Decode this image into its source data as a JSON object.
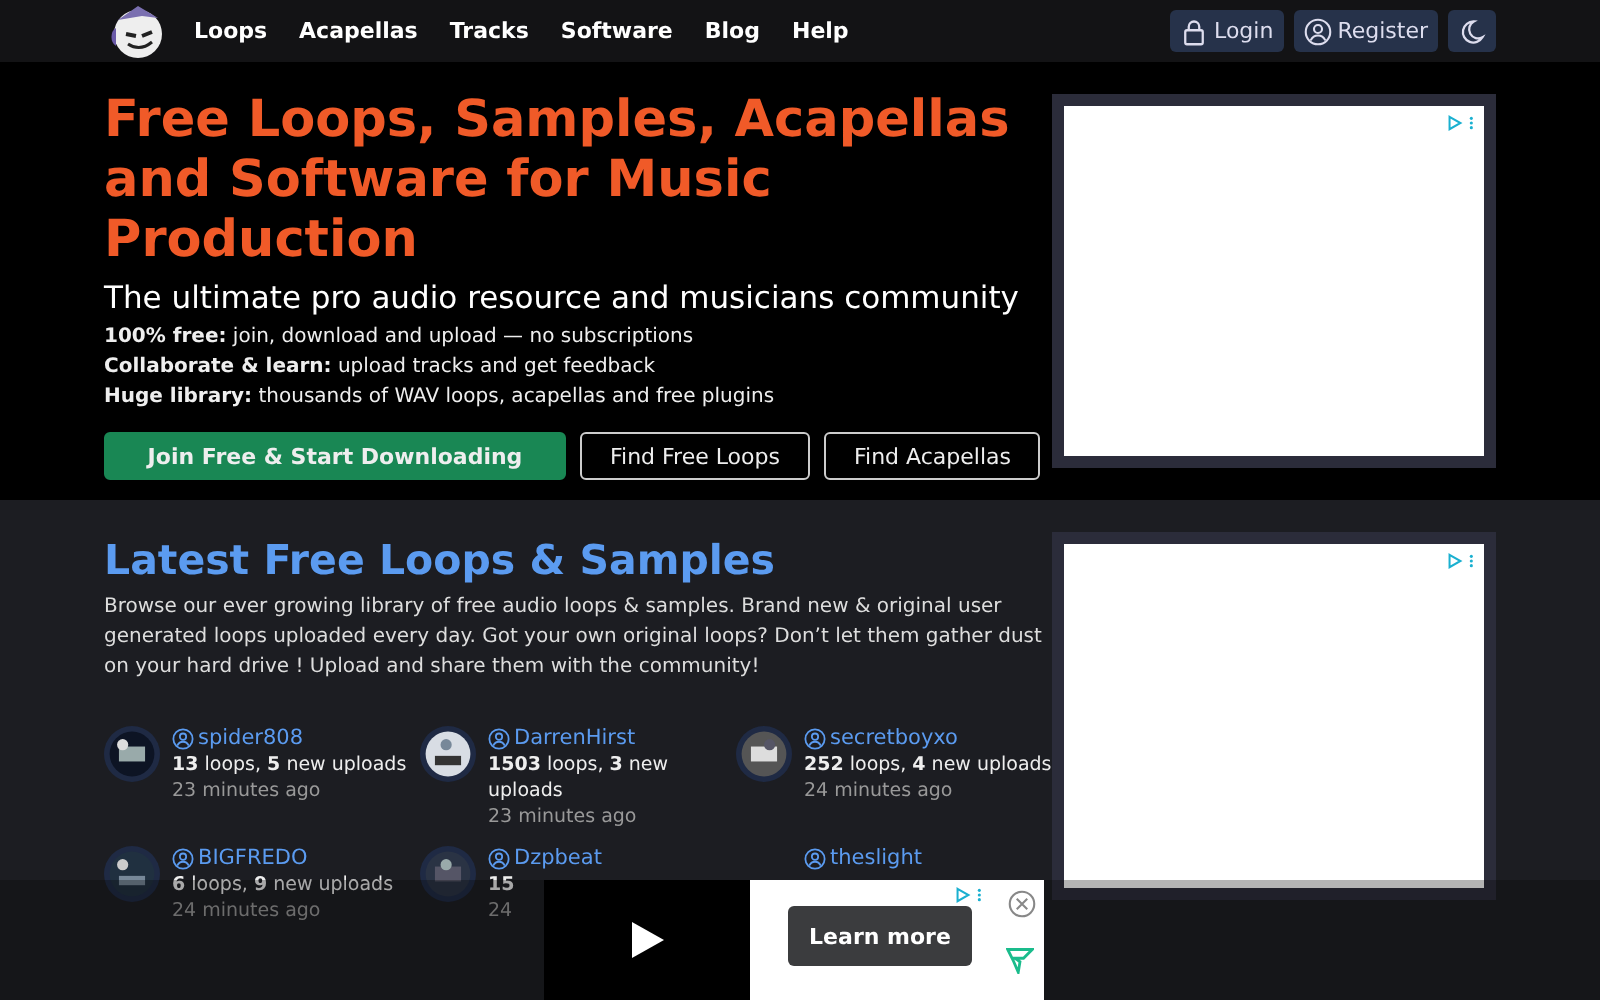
{
  "nav": {
    "links": [
      "Loops",
      "Acapellas",
      "Tracks",
      "Software",
      "Blog",
      "Help"
    ],
    "buttons": [
      {
        "label": "Login",
        "kind": "login"
      },
      {
        "label": "Register",
        "kind": "register"
      }
    ]
  },
  "hero": {
    "title": "Free Loops, Samples, Acapellas and Software for Music Production",
    "subtitle": "The ultimate pro audio resource and musicians community",
    "features": [
      {
        "label": "100% free:",
        "text": "join, download and upload — no subscriptions"
      },
      {
        "label": "Collaborate & learn:",
        "text": "upload tracks and get feedback"
      },
      {
        "label": "Huge library:",
        "text": "thousands of WAV loops, acapellas and free plugins"
      }
    ],
    "buttons": [
      {
        "label": "Join Free & Start Downloading",
        "primary": true
      },
      {
        "label": "Find Free Loops",
        "primary": false
      },
      {
        "label": "Find Acapellas",
        "primary": false
      }
    ]
  },
  "latest": {
    "heading": "Latest Free Loops & Samples",
    "intro": "Browse our ever growing library of free audio loops & samples. Brand new & original user generated loops uploaded every day. Got your own original loops? Don’t let them gather dust on your hard drive ! Upload and share them with the community!",
    "users": [
      {
        "name": "spider808",
        "stats": "**13** loops, **5** new uploads",
        "time": "23 minutes ago"
      },
      {
        "name": "DarrenHirst",
        "stats": "**1503** loops, **3** new uploads",
        "time": "23 minutes ago"
      },
      {
        "name": "secretboyxo",
        "stats": "**252** loops, **4** new uploads",
        "time": "24 minutes ago"
      },
      {
        "name": "BIGFREDO",
        "stats": "**6** loops, **9** new uploads",
        "time": "24 minutes ago"
      },
      {
        "name": "Dzpbeat",
        "stats": "**15**",
        "time": "24"
      },
      {
        "name": "theslight"
      }
    ]
  },
  "ad": {
    "button": "Learn more"
  }
}
